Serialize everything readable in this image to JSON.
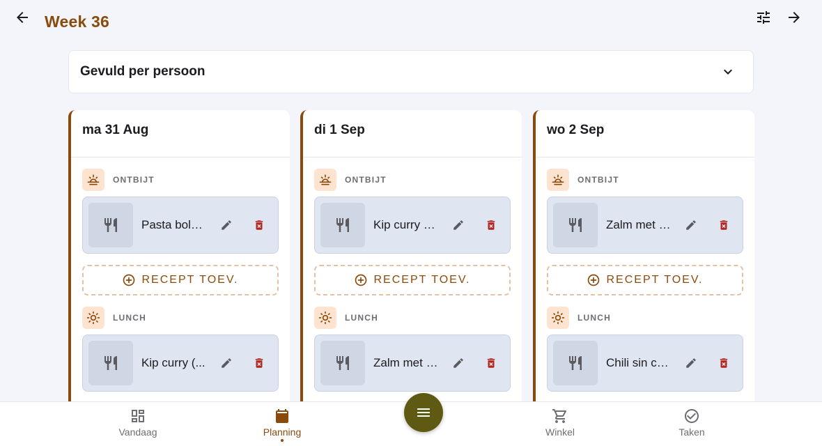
{
  "header": {
    "title": "Week 36"
  },
  "filter": {
    "label": "Gevuld per persoon"
  },
  "add_recipe_label": "RECEPT TOEV.",
  "days": [
    {
      "label": "ma 31 Aug",
      "meals": [
        {
          "type": "ONTBIJT",
          "icon": "sunrise-icon",
          "recipe": "Pasta bolo..."
        },
        {
          "type": "LUNCH",
          "icon": "sun-icon",
          "recipe": "Kip curry (..."
        }
      ]
    },
    {
      "label": "di 1 Sep",
      "meals": [
        {
          "type": "ONTBIJT",
          "icon": "sunrise-icon",
          "recipe": "Kip curry (S)"
        },
        {
          "type": "LUNCH",
          "icon": "sun-icon",
          "recipe": "Zalm met b..."
        }
      ]
    },
    {
      "label": "wo 2 Sep",
      "meals": [
        {
          "type": "ONTBIJT",
          "icon": "sunrise-icon",
          "recipe": "Zalm met b..."
        },
        {
          "type": "LUNCH",
          "icon": "sun-icon",
          "recipe": "Chili sin ca..."
        }
      ]
    }
  ],
  "nav": {
    "today": "Vandaag",
    "planning": "Planning",
    "shop": "Winkel",
    "tasks": "Taken"
  },
  "colors": {
    "accent": "#8a4a0b",
    "fab": "#5e5a14",
    "delete": "#b3261e",
    "card": "#dfe5f1"
  }
}
